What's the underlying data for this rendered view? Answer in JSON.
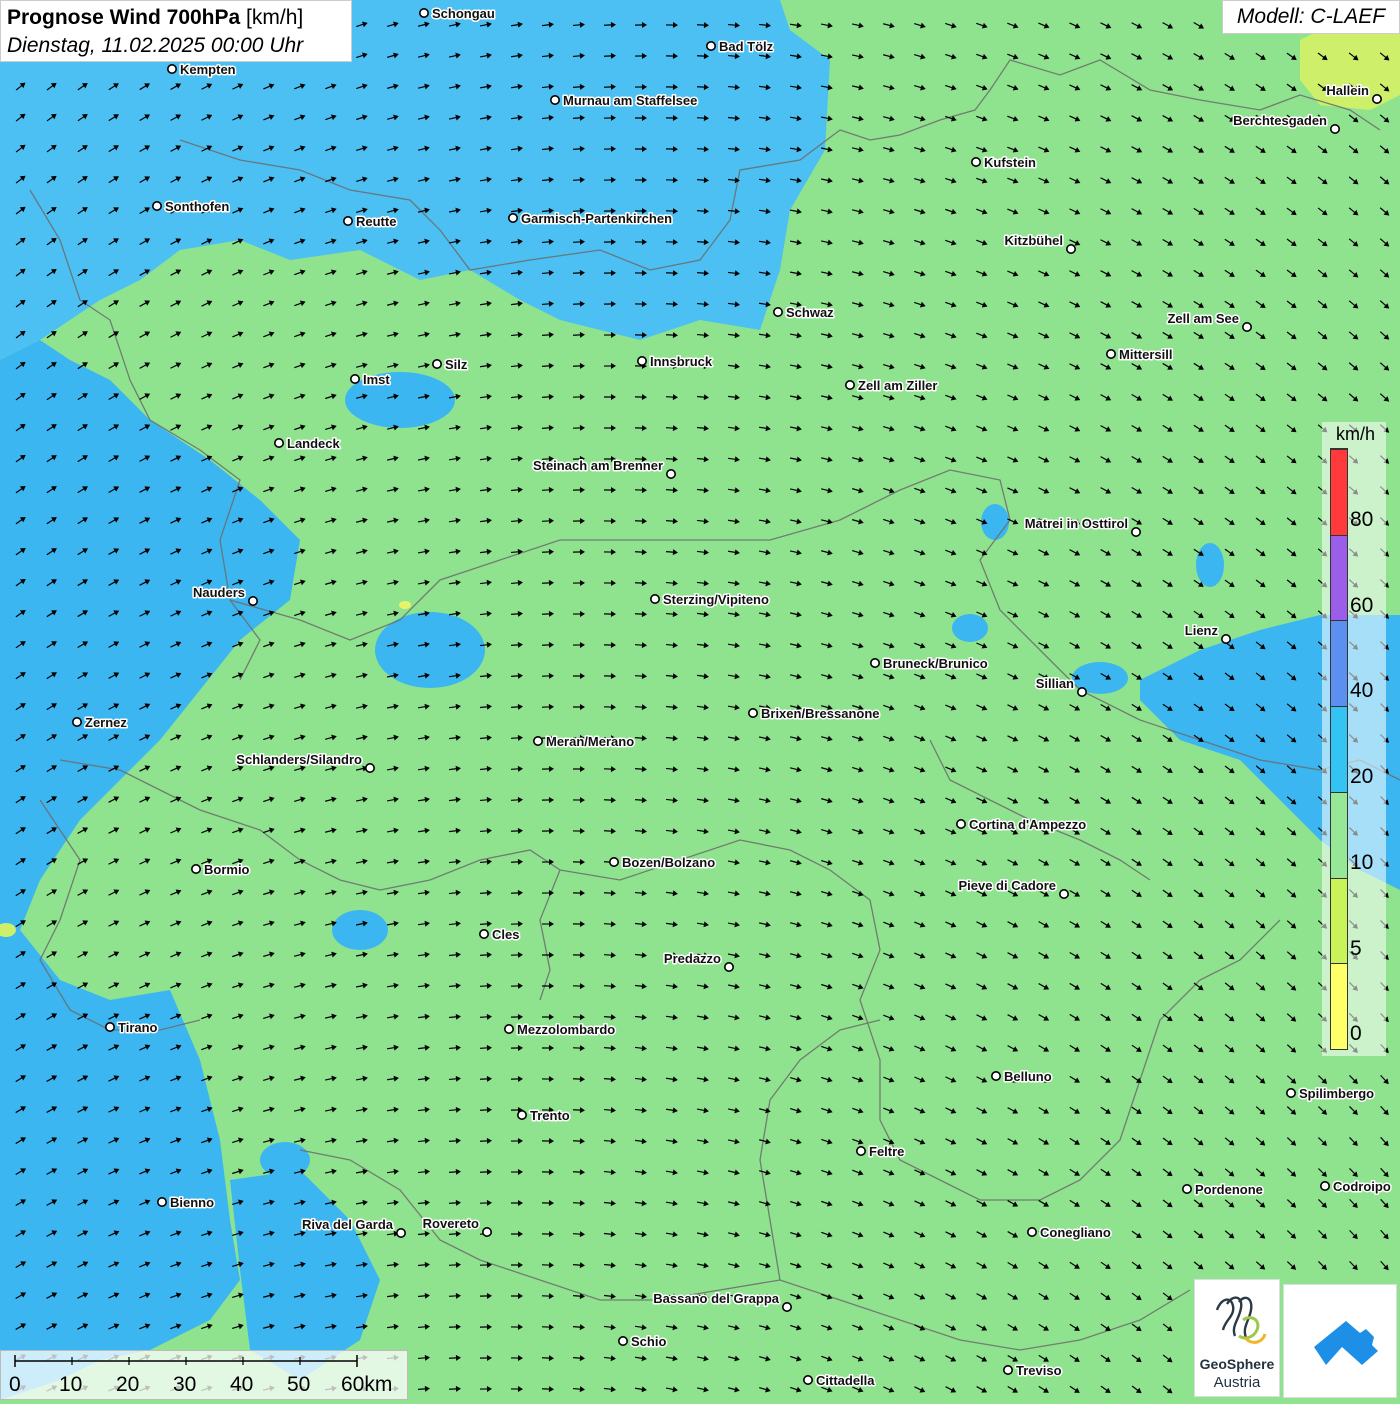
{
  "header": {
    "title_bold": "Prognose Wind 700hPa",
    "title_unit": " [km/h]",
    "date": "Dienstag, 11.02.2025 00:00 Uhr"
  },
  "model_label": "Modell: C-LAEF",
  "legend": {
    "unit": "km/h",
    "ticks": [
      "80",
      "60",
      "40",
      "20",
      "10",
      "5",
      "0"
    ],
    "colors": [
      "#ff3a3a",
      "#9a5ee8",
      "#5c8fef",
      "#33c4f4",
      "#96e896",
      "#c8f45a",
      "#ffff6a"
    ]
  },
  "scalebar": {
    "labels": [
      "0",
      "10",
      "20",
      "30",
      "40",
      "50",
      "60km"
    ]
  },
  "logos": {
    "geosphere_line1": "GeoSphere",
    "geosphere_line2": "Austria"
  },
  "map_colors": {
    "green": "#8fe38f",
    "blue": "#3cb6f0",
    "light_blue": "#4cc0f2",
    "yellow_green": "#cdef6a"
  },
  "cities": [
    {
      "name": "Schongau"
    },
    {
      "name": "Bad Tölz"
    },
    {
      "name": "Kempten"
    },
    {
      "name": "Murnau am Staffelsee"
    },
    {
      "name": "Hallein"
    },
    {
      "name": "Berchtesgaden"
    },
    {
      "name": "Kufstein"
    },
    {
      "name": "Sonthofen"
    },
    {
      "name": "Reutte"
    },
    {
      "name": "Garmisch-Partenkirchen"
    },
    {
      "name": "Kitzbühel"
    },
    {
      "name": "Schwaz"
    },
    {
      "name": "Zell am See"
    },
    {
      "name": "Innsbruck"
    },
    {
      "name": "Mittersill"
    },
    {
      "name": "Silz"
    },
    {
      "name": "Imst"
    },
    {
      "name": "Zell am Ziller"
    },
    {
      "name": "Landeck"
    },
    {
      "name": "Steinach am Brenner"
    },
    {
      "name": "Matrei in Osttirol"
    },
    {
      "name": "Nauders"
    },
    {
      "name": "Sterzing/Vipiteno"
    },
    {
      "name": "Lienz"
    },
    {
      "name": "Bruneck/Brunico"
    },
    {
      "name": "Sillian"
    },
    {
      "name": "Zernez"
    },
    {
      "name": "Brixen/Bressanone"
    },
    {
      "name": "Meran/Merano"
    },
    {
      "name": "Schlanders/Silandro"
    },
    {
      "name": "Cortina d'Ampezzo"
    },
    {
      "name": "Bozen/Bolzano"
    },
    {
      "name": "Bormio"
    },
    {
      "name": "Pieve di Cadore"
    },
    {
      "name": "Cles"
    },
    {
      "name": "Predazzo"
    },
    {
      "name": "Tirano"
    },
    {
      "name": "Mezzolombardo"
    },
    {
      "name": "Belluno"
    },
    {
      "name": "Spilimbergo"
    },
    {
      "name": "Trento"
    },
    {
      "name": "Feltre"
    },
    {
      "name": "Pordenone"
    },
    {
      "name": "Codroipo"
    },
    {
      "name": "Bienno"
    },
    {
      "name": "Riva del Garda"
    },
    {
      "name": "Rovereto"
    },
    {
      "name": "Conegliano"
    },
    {
      "name": "Bassano del Grappa"
    },
    {
      "name": "Schio"
    },
    {
      "name": "Treviso"
    },
    {
      "name": "Cittadella"
    }
  ]
}
